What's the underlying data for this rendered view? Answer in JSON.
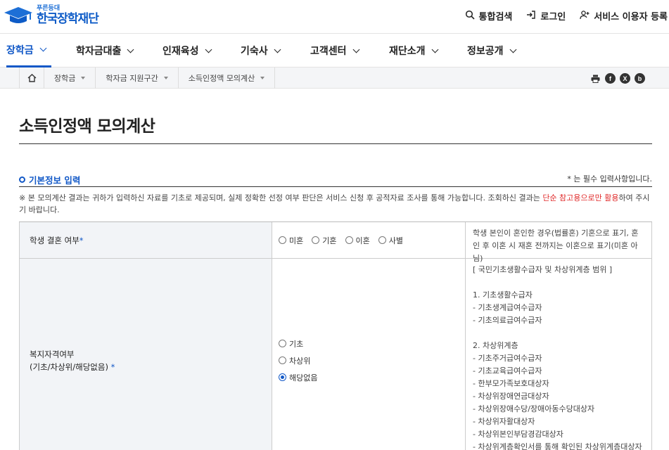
{
  "header": {
    "logo_sub": "푸른등대",
    "logo_main": "한국장학재단",
    "util": [
      {
        "icon": "search-icon",
        "label": "통합검색"
      },
      {
        "icon": "login-icon",
        "label": "로그인"
      },
      {
        "icon": "user-add-icon",
        "label": "서비스 이용자 등록"
      }
    ]
  },
  "gnb": [
    {
      "label": "장학금",
      "active": true
    },
    {
      "label": "학자금대출"
    },
    {
      "label": "인재육성"
    },
    {
      "label": "기숙사"
    },
    {
      "label": "고객센터"
    },
    {
      "label": "재단소개"
    },
    {
      "label": "정보공개"
    }
  ],
  "breadcrumb": [
    "장학금",
    "학자금 지원구간",
    "소득인정액 모의계산"
  ],
  "share_icons": [
    "print-icon",
    "facebook-icon",
    "x-icon",
    "blog-icon"
  ],
  "page_title": "소득인정액 모의계산",
  "section": {
    "title": "기본정보 입력",
    "required_note": "* 는 필수 입력사항입니다."
  },
  "notice": {
    "prefix": "※ 본 모의계산 결과는 귀하가 입력하신 자료를 기초로 제공되며, 실제 정확한 선정 여부 판단은 서비스 신청 후 공적자료 조사를 통해 가능합니다. 조회하신 결과는 ",
    "highlight": "단순 참고용으로만 활용",
    "suffix": "하여 주시기 바랍니다."
  },
  "rows": {
    "marriage": {
      "label": "학생 결혼 여부",
      "star": "*",
      "options": [
        "미혼",
        "기혼",
        "이혼",
        "사별"
      ],
      "help": "학생 본인이 혼인한 경우(법률혼) 기혼으로 표기, 혼인 후 이혼 시 재혼 전까지는 이혼으로 표기(미혼 아님)"
    },
    "welfare": {
      "label_line1": "복지자격여부",
      "label_line2": "(기초/차상위/해당없음)",
      "star": "*",
      "options": [
        "기초",
        "차상위",
        "해당없음"
      ],
      "selected": "해당없음",
      "help": [
        "[ 국민기초생활수급자 및 차상위계층 범위 ]",
        "",
        "1. 기초생활수급자",
        "- 기초생계급여수급자",
        "- 기초의료급여수급자",
        "",
        "2. 차상위계층",
        "- 기초주거급여수급자",
        "- 기초교육급여수급자",
        "- 한부모가족보호대상자",
        "- 차상위장애연금대상자",
        "- 차상위장애수당/장애아동수당대상자",
        "- 차상위자활대상자",
        "- 차상위본인부담경감대상자",
        "- 차상위계층확인서를 통해 확인된 차상위계층대상자"
      ]
    }
  },
  "colors": {
    "brand": "#1158c7",
    "highlight": "#e02b2b"
  }
}
